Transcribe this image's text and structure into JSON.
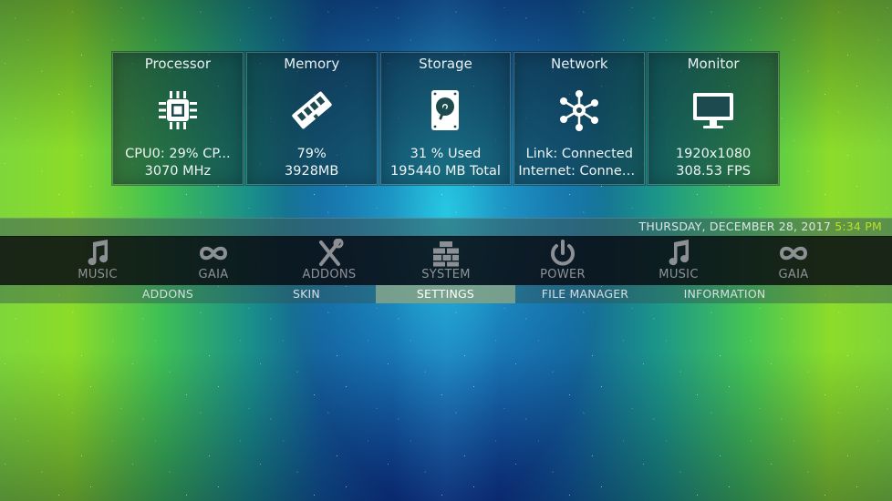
{
  "panels": [
    {
      "title": "Processor",
      "icon": "cpu-icon",
      "line1": "CPU0:  29% CP...",
      "line2": "3070 MHz"
    },
    {
      "title": "Memory",
      "icon": "ram-icon",
      "line1": "79%",
      "line2": "3928MB"
    },
    {
      "title": "Storage",
      "icon": "hard-drive-icon",
      "line1": "31 % Used",
      "line2": "195440 MB Total"
    },
    {
      "title": "Network",
      "icon": "network-icon",
      "line1": "Link: Connected",
      "line2": "Internet: Connect..."
    },
    {
      "title": "Monitor",
      "icon": "monitor-icon",
      "line1": "1920x1080",
      "line2": "308.53 FPS"
    }
  ],
  "datebar": {
    "date": "THURSDAY, DECEMBER 28, 2017",
    "time": "5:34 PM"
  },
  "mainmenu": [
    {
      "label": "MUSIC",
      "icon": "music-note-icon"
    },
    {
      "label": "GAIA",
      "icon": "infinity-icon"
    },
    {
      "label": "ADDONS",
      "icon": "tools-icon"
    },
    {
      "label": "SYSTEM",
      "icon": "brick-wall-icon"
    },
    {
      "label": "POWER",
      "icon": "power-icon"
    },
    {
      "label": "MUSIC",
      "icon": "music-note-icon"
    },
    {
      "label": "GAIA",
      "icon": "infinity-icon"
    }
  ],
  "submenu": [
    {
      "label": "ADDONS"
    },
    {
      "label": "SKIN"
    },
    {
      "label": "SETTINGS",
      "active": true
    },
    {
      "label": "FILE MANAGER"
    },
    {
      "label": "INFORMATION"
    }
  ],
  "colors": {
    "time_accent": "#b8e22a",
    "active_submenu": "#8caa8c"
  }
}
